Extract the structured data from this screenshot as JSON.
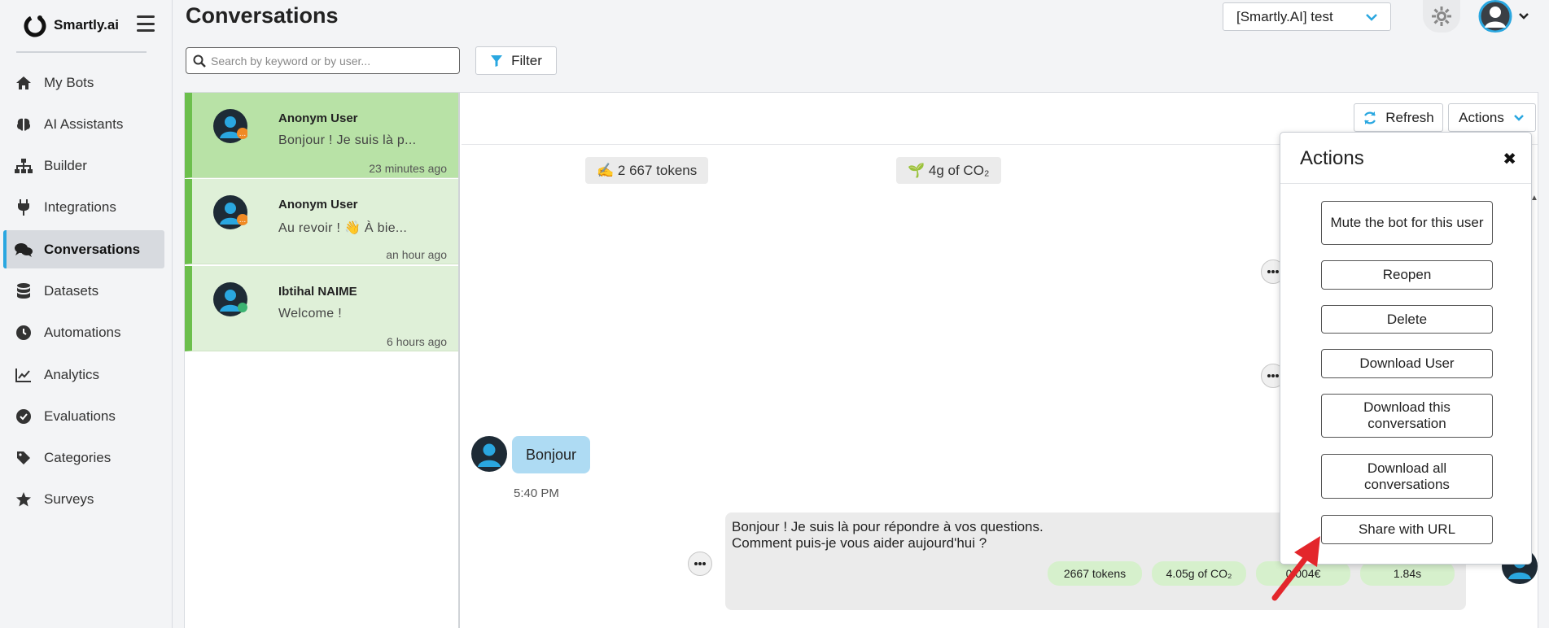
{
  "brand": {
    "name": "Smartly.ai"
  },
  "sidebar": {
    "items": [
      {
        "label": "My Bots",
        "icon": "home-icon"
      },
      {
        "label": "AI Assistants",
        "icon": "brain-icon"
      },
      {
        "label": "Builder",
        "icon": "sitemap-icon"
      },
      {
        "label": "Integrations",
        "icon": "plug-icon"
      },
      {
        "label": "Conversations",
        "icon": "comments-icon",
        "active": true
      },
      {
        "label": "Datasets",
        "icon": "database-icon"
      },
      {
        "label": "Automations",
        "icon": "clock-icon"
      },
      {
        "label": "Analytics",
        "icon": "chart-line-icon"
      },
      {
        "label": "Evaluations",
        "icon": "check-circle-icon"
      },
      {
        "label": "Categories",
        "icon": "tag-icon"
      },
      {
        "label": "Surveys",
        "icon": "star-icon"
      }
    ]
  },
  "header": {
    "title": "Conversations",
    "bot_select": "[Smartly.AI] test"
  },
  "search": {
    "placeholder": "Search by keyword or by user..."
  },
  "filter": {
    "label": "Filter"
  },
  "conversations": [
    {
      "name": "Anonym User",
      "preview": "Bonjour ! Je suis là p...",
      "time": "23 minutes ago",
      "badge": "orange",
      "selected": true
    },
    {
      "name": "Anonym User",
      "preview": "Au revoir ! 👋 À bie...",
      "time": "an hour ago",
      "badge": "orange",
      "selected": false
    },
    {
      "name": "Ibtihal NAIME",
      "preview": "Welcome !",
      "time": "6 hours ago",
      "badge": "green",
      "selected": false
    }
  ],
  "chat": {
    "refresh_label": "Refresh",
    "actions_label": "Actions",
    "tokens_pill": "✍️ 2 667 tokens",
    "co2_pill": "🌱 4g of CO₂",
    "user_message": "Bonjour",
    "user_message_time": "5:40 PM",
    "bot_message_line1": "Bonjour ! Je suis là pour répondre à vos questions.",
    "bot_message_line2": "Comment puis-je vous aider aujourd'hui ?",
    "stats": [
      "2667 tokens",
      "4.05g of CO₂",
      "0.004€",
      "1.84s"
    ]
  },
  "actions_popover": {
    "title": "Actions",
    "close": "✖",
    "buttons": [
      "Mute the bot for this user",
      "Reopen",
      "Delete",
      "Download User",
      "Download this conversation",
      "Download all conversations",
      "Share with URL"
    ]
  },
  "colors": {
    "accent": "#2aa7e0",
    "conv_bg": "#dff0d8",
    "conv_selected": "#b8e2a6",
    "conv_border": "#6cbf4c",
    "arrow": "#e3262b"
  }
}
